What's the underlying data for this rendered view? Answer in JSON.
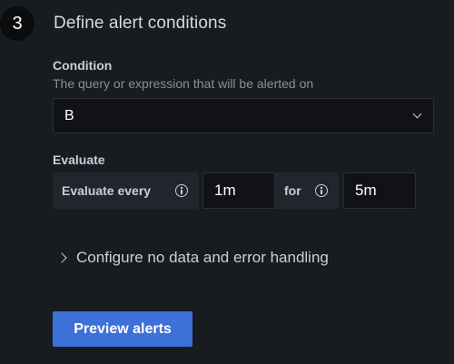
{
  "step": {
    "number": "3",
    "title": "Define alert conditions"
  },
  "condition": {
    "label": "Condition",
    "description": "The query or expression that will be alerted on",
    "selected": "B"
  },
  "evaluate": {
    "label": "Evaluate",
    "every_label": "Evaluate every",
    "every_value": "1m",
    "for_label": "for",
    "for_value": "5m"
  },
  "no_data_section": {
    "label": "Configure no data and error handling"
  },
  "actions": {
    "preview_label": "Preview alerts"
  },
  "colors": {
    "background": "#181b1f",
    "primary_button": "#3d71d9",
    "input_background": "#111217",
    "label_box": "#22252b"
  }
}
